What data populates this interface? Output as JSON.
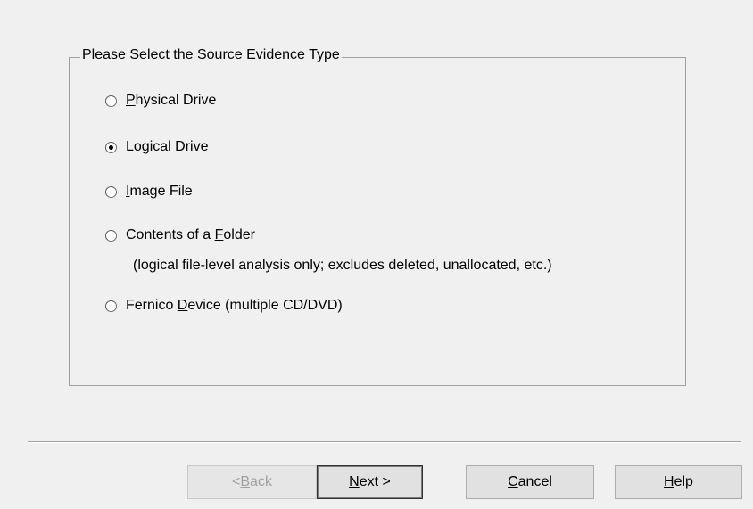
{
  "group": {
    "title": "Please Select the Source Evidence Type"
  },
  "options": [
    {
      "pre": "",
      "key": "P",
      "post": "hysical Drive",
      "checked": false
    },
    {
      "pre": "",
      "key": "L",
      "post": "ogical Drive",
      "checked": true
    },
    {
      "pre": "",
      "key": "I",
      "post": "mage File",
      "checked": false
    },
    {
      "pre": "Contents of a ",
      "key": "F",
      "post": "older",
      "checked": false,
      "note": "(logical file-level analysis only; excludes deleted, unallocated, etc.)"
    },
    {
      "pre": "Fernico ",
      "key": "D",
      "post": "evice (multiple CD/DVD)",
      "checked": false
    }
  ],
  "buttons": {
    "back": {
      "pre": "< ",
      "key": "B",
      "post": "ack",
      "enabled": false
    },
    "next": {
      "pre": "",
      "key": "N",
      "post": "ext >",
      "enabled": true
    },
    "cancel": {
      "pre": "",
      "key": "C",
      "post": "ancel",
      "enabled": true
    },
    "help": {
      "pre": "",
      "key": "H",
      "post": "elp",
      "enabled": true
    }
  }
}
